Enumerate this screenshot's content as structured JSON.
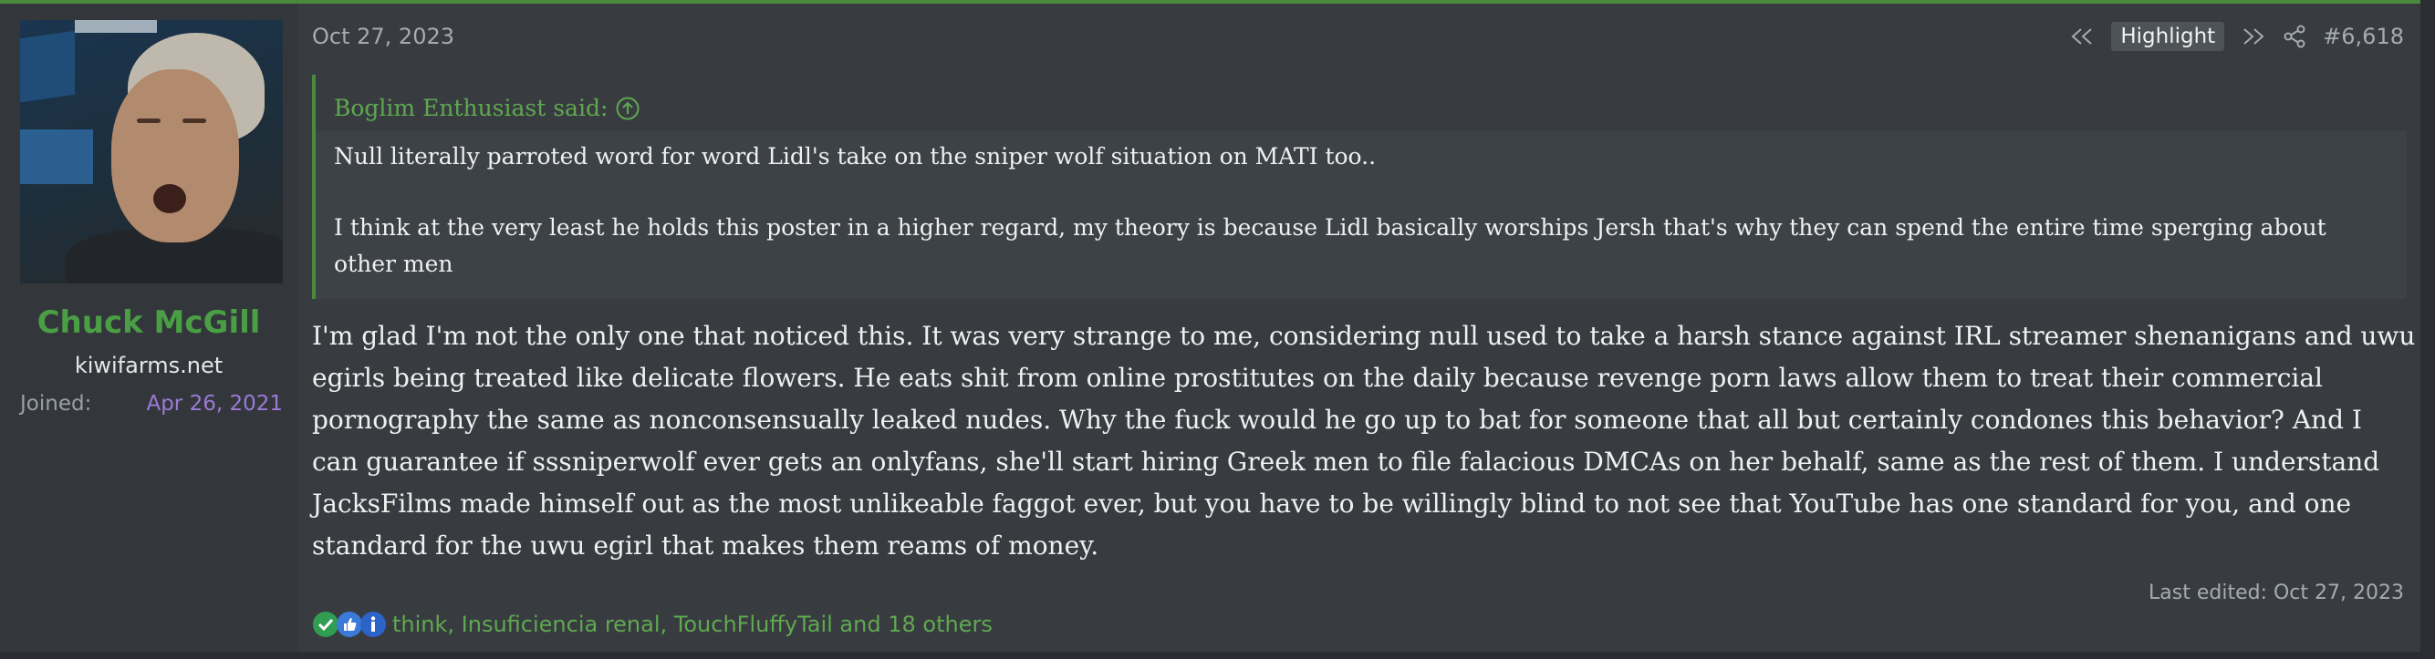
{
  "user": {
    "name": "Chuck McGill",
    "title": "kiwifarms.net",
    "joined_label": "Joined:",
    "joined_date": "Apr 26, 2021"
  },
  "post": {
    "date": "Oct 27, 2023",
    "highlight_label": "Highlight",
    "number": "#6,618",
    "quote": {
      "author": "Boglim Enthusiast said:",
      "paragraphs": [
        "Null literally parroted word for word Lidl's take on the sniper wolf situation on MATI too..",
        "I think at the very least he holds this poster in a higher regard, my theory is because Lidl basically worships Jersh that's why they can spend the entire time sperging about other men"
      ]
    },
    "message": "I'm glad I'm not the only one that noticed this. It was very strange to me, considering null used to take a harsh stance against IRL streamer shenanigans and uwu egirls being treated like delicate flowers. He eats shit from online prostitutes on the daily because revenge porn laws allow them to treat their commercial pornography the same as nonconsensually leaked nudes. Why the fuck would he go up to bat for someone that all but certainly condones this behavior? And I can guarantee if sssniperwolf ever gets an onlyfans, she'll start hiring Greek men to file falacious DMCAs on her behalf, same as the rest of them. I understand JacksFilms made himself out as the most unlikeable faggot ever, but you have to be willingly blind to not see that YouTube has one standard for you, and one standard for the uwu egirl that makes them reams of money.",
    "last_edited": "Last edited: Oct 27, 2023",
    "reactions_text": "think, Insuficiencia renal, TouchFluffyTail and 18 others",
    "reaction_icons": [
      "check-reaction-icon",
      "thumbs-up-reaction-icon",
      "informative-reaction-icon"
    ]
  },
  "colors": {
    "accent_green": "#4a9e44",
    "link_green": "#5fa84f",
    "joined_purple": "#9b7ad6"
  }
}
